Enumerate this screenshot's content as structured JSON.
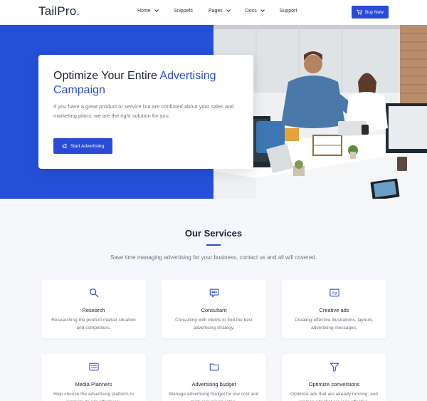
{
  "header": {
    "logo_name": "TailPro",
    "logo_dot": ".",
    "nav": [
      {
        "label": "Home",
        "has_dropdown": true
      },
      {
        "label": "Snippets",
        "has_dropdown": false
      },
      {
        "label": "Pages",
        "has_dropdown": true
      },
      {
        "label": "Docs",
        "has_dropdown": true
      },
      {
        "label": "Support",
        "has_dropdown": false
      }
    ],
    "buy_label": "Buy Now"
  },
  "hero": {
    "title_plain": "Optimize Your Entire ",
    "title_accent": "Advertising Campaign",
    "description": "If you have a great product or service but are confused about your sales and marketing plans, we are the right solution for you.",
    "cta_label": "Start Advertising"
  },
  "services": {
    "title_plain": "Our ",
    "title_bold": "Services",
    "subtitle": "Save time managing advertising for your business, contact us and all will covered.",
    "cards": [
      {
        "icon": "search-icon",
        "title": "Research",
        "desc": "Researching the product market situation and competitors."
      },
      {
        "icon": "chat-icon",
        "title": "Consultant",
        "desc": "Consulting with clients to find the best advertising strategy."
      },
      {
        "icon": "ad-icon",
        "title": "Creative ads",
        "desc": "Creating effective illustrations, layouts, advertising messages."
      },
      {
        "icon": "list-icon",
        "title": "Media Planners",
        "desc": "Help choose the advertising platform to promote its ads effectively."
      },
      {
        "icon": "folder-icon",
        "title": "Advertising budget",
        "desc": "Manage advertising budget for low cost and high conversion rates."
      },
      {
        "icon": "filter-icon",
        "title": "Optimize conversions",
        "desc": "Optimize ads that are already running, and replace ads that are less effective."
      }
    ]
  },
  "colors": {
    "accent": "#2a4bd8",
    "hero_blue": "#2450d9",
    "services_bg": "#f6f7fb"
  }
}
